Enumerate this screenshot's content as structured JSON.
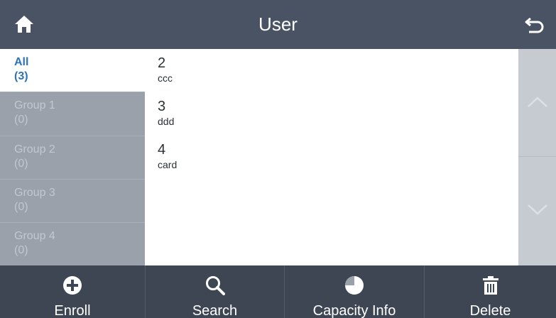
{
  "header": {
    "title": "User",
    "home_icon": "home-icon",
    "back_icon": "back-arrow-icon"
  },
  "groups": [
    {
      "name": "All",
      "count": "(3)",
      "active": true
    },
    {
      "name": "Group 1",
      "count": "(0)",
      "active": false
    },
    {
      "name": "Group 2",
      "count": "(0)",
      "active": false
    },
    {
      "name": "Group 3",
      "count": "(0)",
      "active": false
    },
    {
      "name": "Group 4",
      "count": "(0)",
      "active": false
    }
  ],
  "users": [
    {
      "id": "2",
      "name": "ccc"
    },
    {
      "id": "3",
      "name": "ddd"
    },
    {
      "id": "4",
      "name": "card"
    }
  ],
  "scroll": {
    "up_icon": "chevron-up-icon",
    "down_icon": "chevron-down-icon"
  },
  "footer": {
    "buttons": [
      {
        "label": "Enroll",
        "icon": "plus-circle-icon"
      },
      {
        "label": "Search",
        "icon": "search-icon"
      },
      {
        "label": "Capacity Info",
        "icon": "pie-chart-icon"
      },
      {
        "label": "Delete",
        "icon": "trash-icon"
      }
    ]
  },
  "colors": {
    "header_bg": "#4a5363",
    "footer_bg": "#3e4654",
    "accent": "#2f73b7",
    "inactive_group_bg": "#9aa1ab",
    "scroll_bg": "#c6cbd1"
  }
}
